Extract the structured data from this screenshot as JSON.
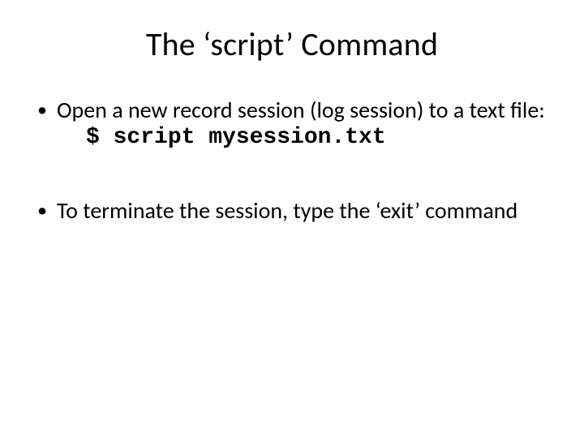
{
  "slide": {
    "title": "The ‘script’ Command",
    "bullets": [
      {
        "text": "Open a new record session (log session) to a text file:",
        "code": "$ script mysession.txt"
      },
      {
        "text": "To terminate the session, type the ‘exit’ command"
      }
    ]
  }
}
